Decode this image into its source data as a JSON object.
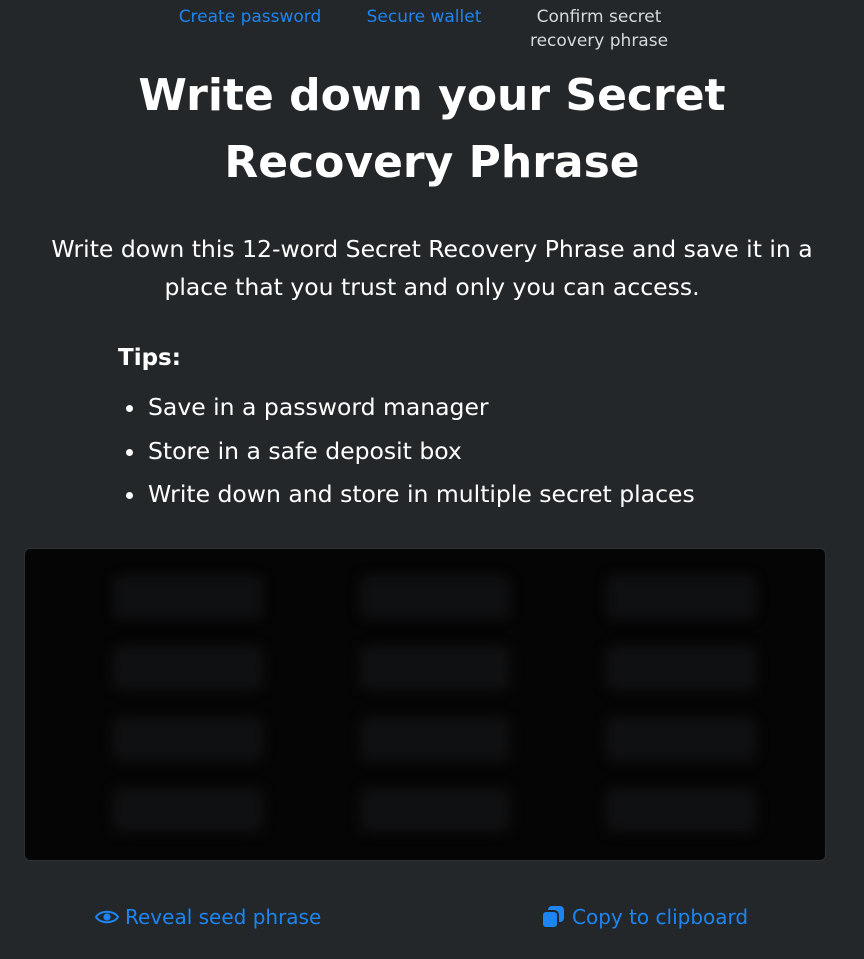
{
  "steps": [
    {
      "label": "Create password"
    },
    {
      "label": "Secure wallet"
    },
    {
      "label": "Confirm secret recovery phrase"
    }
  ],
  "title": "Write down your Secret Recovery Phrase",
  "description": "Write down this 12-word Secret Recovery Phrase and save it in a place that you trust and only you can access.",
  "tips": {
    "heading": "Tips:",
    "items": [
      "Save in a password manager",
      "Store in a safe deposit box",
      "Write down and store in multiple secret places"
    ]
  },
  "actions": {
    "reveal_label": "Reveal seed phrase",
    "copy_label": "Copy to clipboard"
  },
  "colors": {
    "background": "#24272a",
    "accent": "#1c85f2",
    "phrase_box": "#050505"
  },
  "icons": {
    "reveal": "eye-icon",
    "copy": "copy-icon"
  }
}
